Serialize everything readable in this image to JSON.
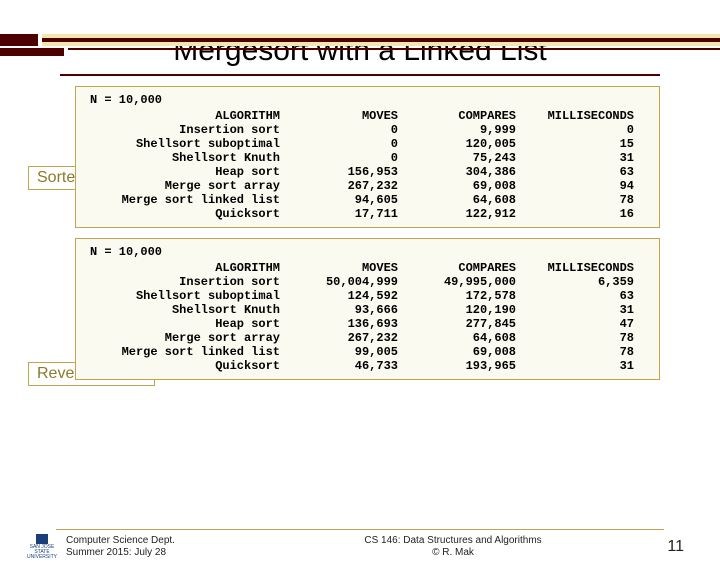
{
  "title": "Mergesort with a Linked List",
  "label_sorted": "Sorted",
  "label_reverse": "Reverse sorted",
  "n_line": "N = 10,000",
  "headers": {
    "alg": "ALGORITHM",
    "mov": "MOVES",
    "cmp": "COMPARES",
    "ms": "MILLISECONDS"
  },
  "sorted_rows": [
    {
      "alg": "Insertion sort",
      "mov": "0",
      "cmp": "9,999",
      "ms": "0"
    },
    {
      "alg": "Shellsort suboptimal",
      "mov": "0",
      "cmp": "120,005",
      "ms": "15"
    },
    {
      "alg": "Shellsort Knuth",
      "mov": "0",
      "cmp": "75,243",
      "ms": "31"
    },
    {
      "alg": "Heap sort",
      "mov": "156,953",
      "cmp": "304,386",
      "ms": "63"
    },
    {
      "alg": "Merge sort array",
      "mov": "267,232",
      "cmp": "69,008",
      "ms": "94"
    },
    {
      "alg": "Merge sort linked list",
      "mov": "94,605",
      "cmp": "64,608",
      "ms": "78"
    },
    {
      "alg": "Quicksort",
      "mov": "17,711",
      "cmp": "122,912",
      "ms": "16"
    }
  ],
  "reverse_rows": [
    {
      "alg": "Insertion sort",
      "mov": "50,004,999",
      "cmp": "49,995,000",
      "ms": "6,359"
    },
    {
      "alg": "Shellsort suboptimal",
      "mov": "124,592",
      "cmp": "172,578",
      "ms": "63"
    },
    {
      "alg": "Shellsort Knuth",
      "mov": "93,666",
      "cmp": "120,190",
      "ms": "31"
    },
    {
      "alg": "Heap sort",
      "mov": "136,693",
      "cmp": "277,845",
      "ms": "47"
    },
    {
      "alg": "Merge sort array",
      "mov": "267,232",
      "cmp": "64,608",
      "ms": "78"
    },
    {
      "alg": "Merge sort linked list",
      "mov": "99,005",
      "cmp": "69,008",
      "ms": "78"
    },
    {
      "alg": "Quicksort",
      "mov": "46,733",
      "cmp": "193,965",
      "ms": "31"
    }
  ],
  "footer": {
    "dept": "Computer Science Dept.",
    "term": "Summer 2015: July 28",
    "course": "CS 146: Data Structures and Algorithms",
    "author": "© R. Mak",
    "page": "11",
    "univ1": "SAN JOSE STATE",
    "univ2": "UNIVERSITY"
  }
}
